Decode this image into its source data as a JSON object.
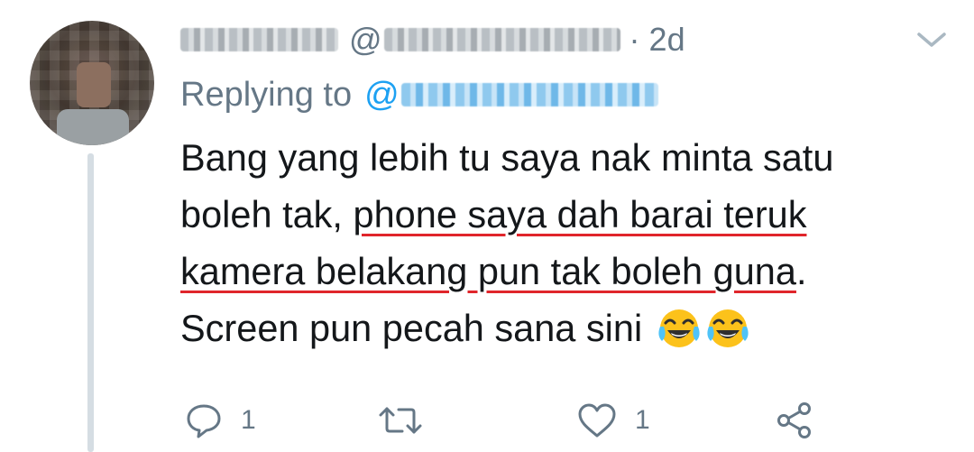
{
  "tweet": {
    "time_separator": "·",
    "time": "2d",
    "handle_at": "@",
    "replying_label": "Replying to",
    "replying_at": "@",
    "text_lines": [
      {
        "plain": "Bang yang lebih tu saya nak minta satu"
      },
      {
        "plain": "boleh tak, ",
        "underlined": "phone saya dah barai teruk"
      },
      {
        "underlined": "kamera belakang pun tak boleh guna",
        "plain_after": "."
      },
      {
        "plain": "Screen pun pecah sana sini "
      }
    ],
    "emojis": [
      "face-with-tears-of-joy",
      "face-with-tears-of-joy"
    ]
  },
  "actions": {
    "reply_count": "1",
    "retweet_count": "",
    "like_count": "1"
  },
  "colors": {
    "secondary_text": "#657786",
    "primary_text": "#14171a",
    "link_blue": "#1da1f2",
    "underline_red": "#e0252b",
    "thread_line": "#d5dde3"
  }
}
